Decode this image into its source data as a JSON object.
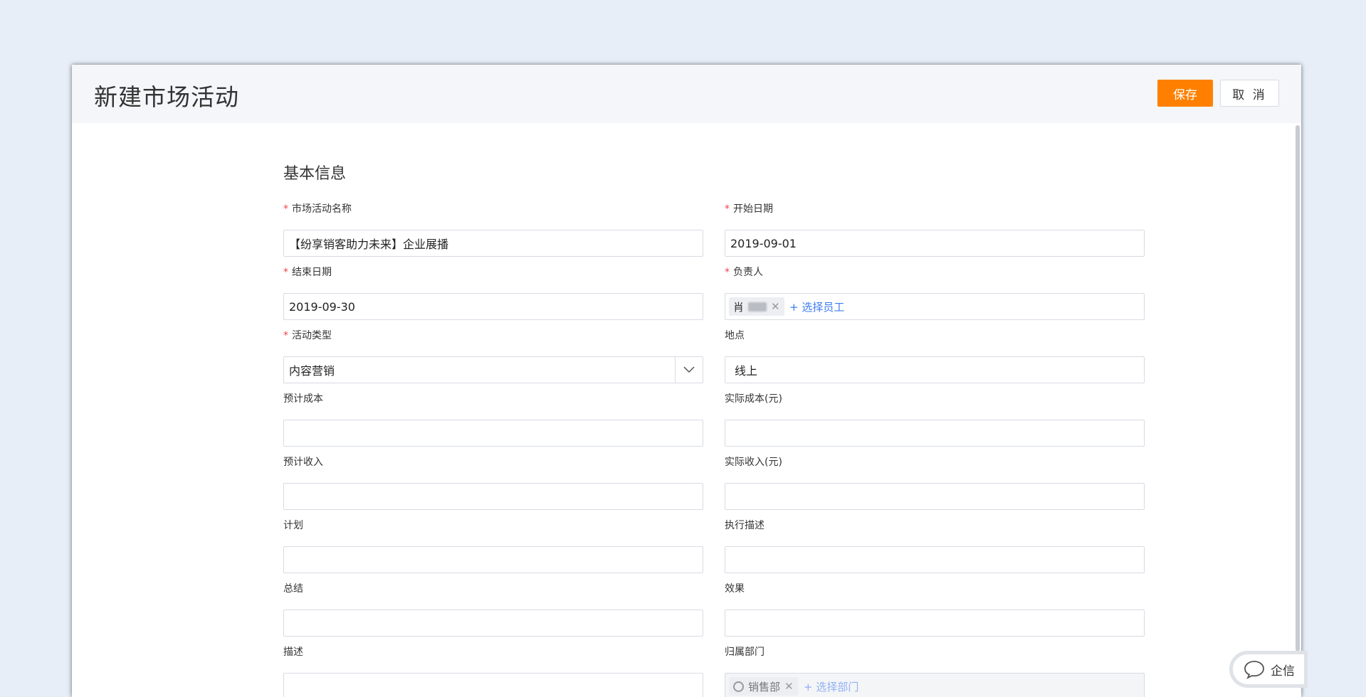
{
  "header": {
    "title": "新建市场活动",
    "save_label": "保存",
    "cancel_label": "取 消"
  },
  "section": {
    "title": "基本信息"
  },
  "fields": {
    "name": {
      "label": "市场活动名称",
      "required": true,
      "value": "【纷享销客助力未来】企业展播"
    },
    "start": {
      "label": "开始日期",
      "required": true,
      "value": "2019-09-01"
    },
    "end": {
      "label": "结束日期",
      "required": true,
      "value": "2019-09-30"
    },
    "owner": {
      "label": "负责人",
      "required": true,
      "tag": "肖",
      "add_label": "+ 选择员工"
    },
    "type": {
      "label": "活动类型",
      "required": true,
      "value": "内容营销"
    },
    "location": {
      "label": "地点",
      "value": "线上"
    },
    "est_cost": {
      "label": "预计成本",
      "value": ""
    },
    "act_cost": {
      "label": "实际成本(元)",
      "value": ""
    },
    "est_income": {
      "label": "预计收入",
      "value": ""
    },
    "act_income": {
      "label": "实际收入(元)",
      "value": ""
    },
    "plan": {
      "label": "计划",
      "value": ""
    },
    "exec_desc": {
      "label": "执行描述",
      "value": ""
    },
    "summary": {
      "label": "总结",
      "value": ""
    },
    "effect": {
      "label": "效果",
      "value": ""
    },
    "desc": {
      "label": "描述",
      "value": ""
    },
    "dept": {
      "label": "归属部门",
      "tag": "销售部",
      "add_label": "+ 选择部门"
    }
  },
  "chat_widget": {
    "label": "企信",
    "icon": "chat-bubble-icon"
  },
  "colors": {
    "accent": "#ff8000",
    "link": "#3d7cf2",
    "required": "#f5434b",
    "background": "#e7eef8"
  }
}
